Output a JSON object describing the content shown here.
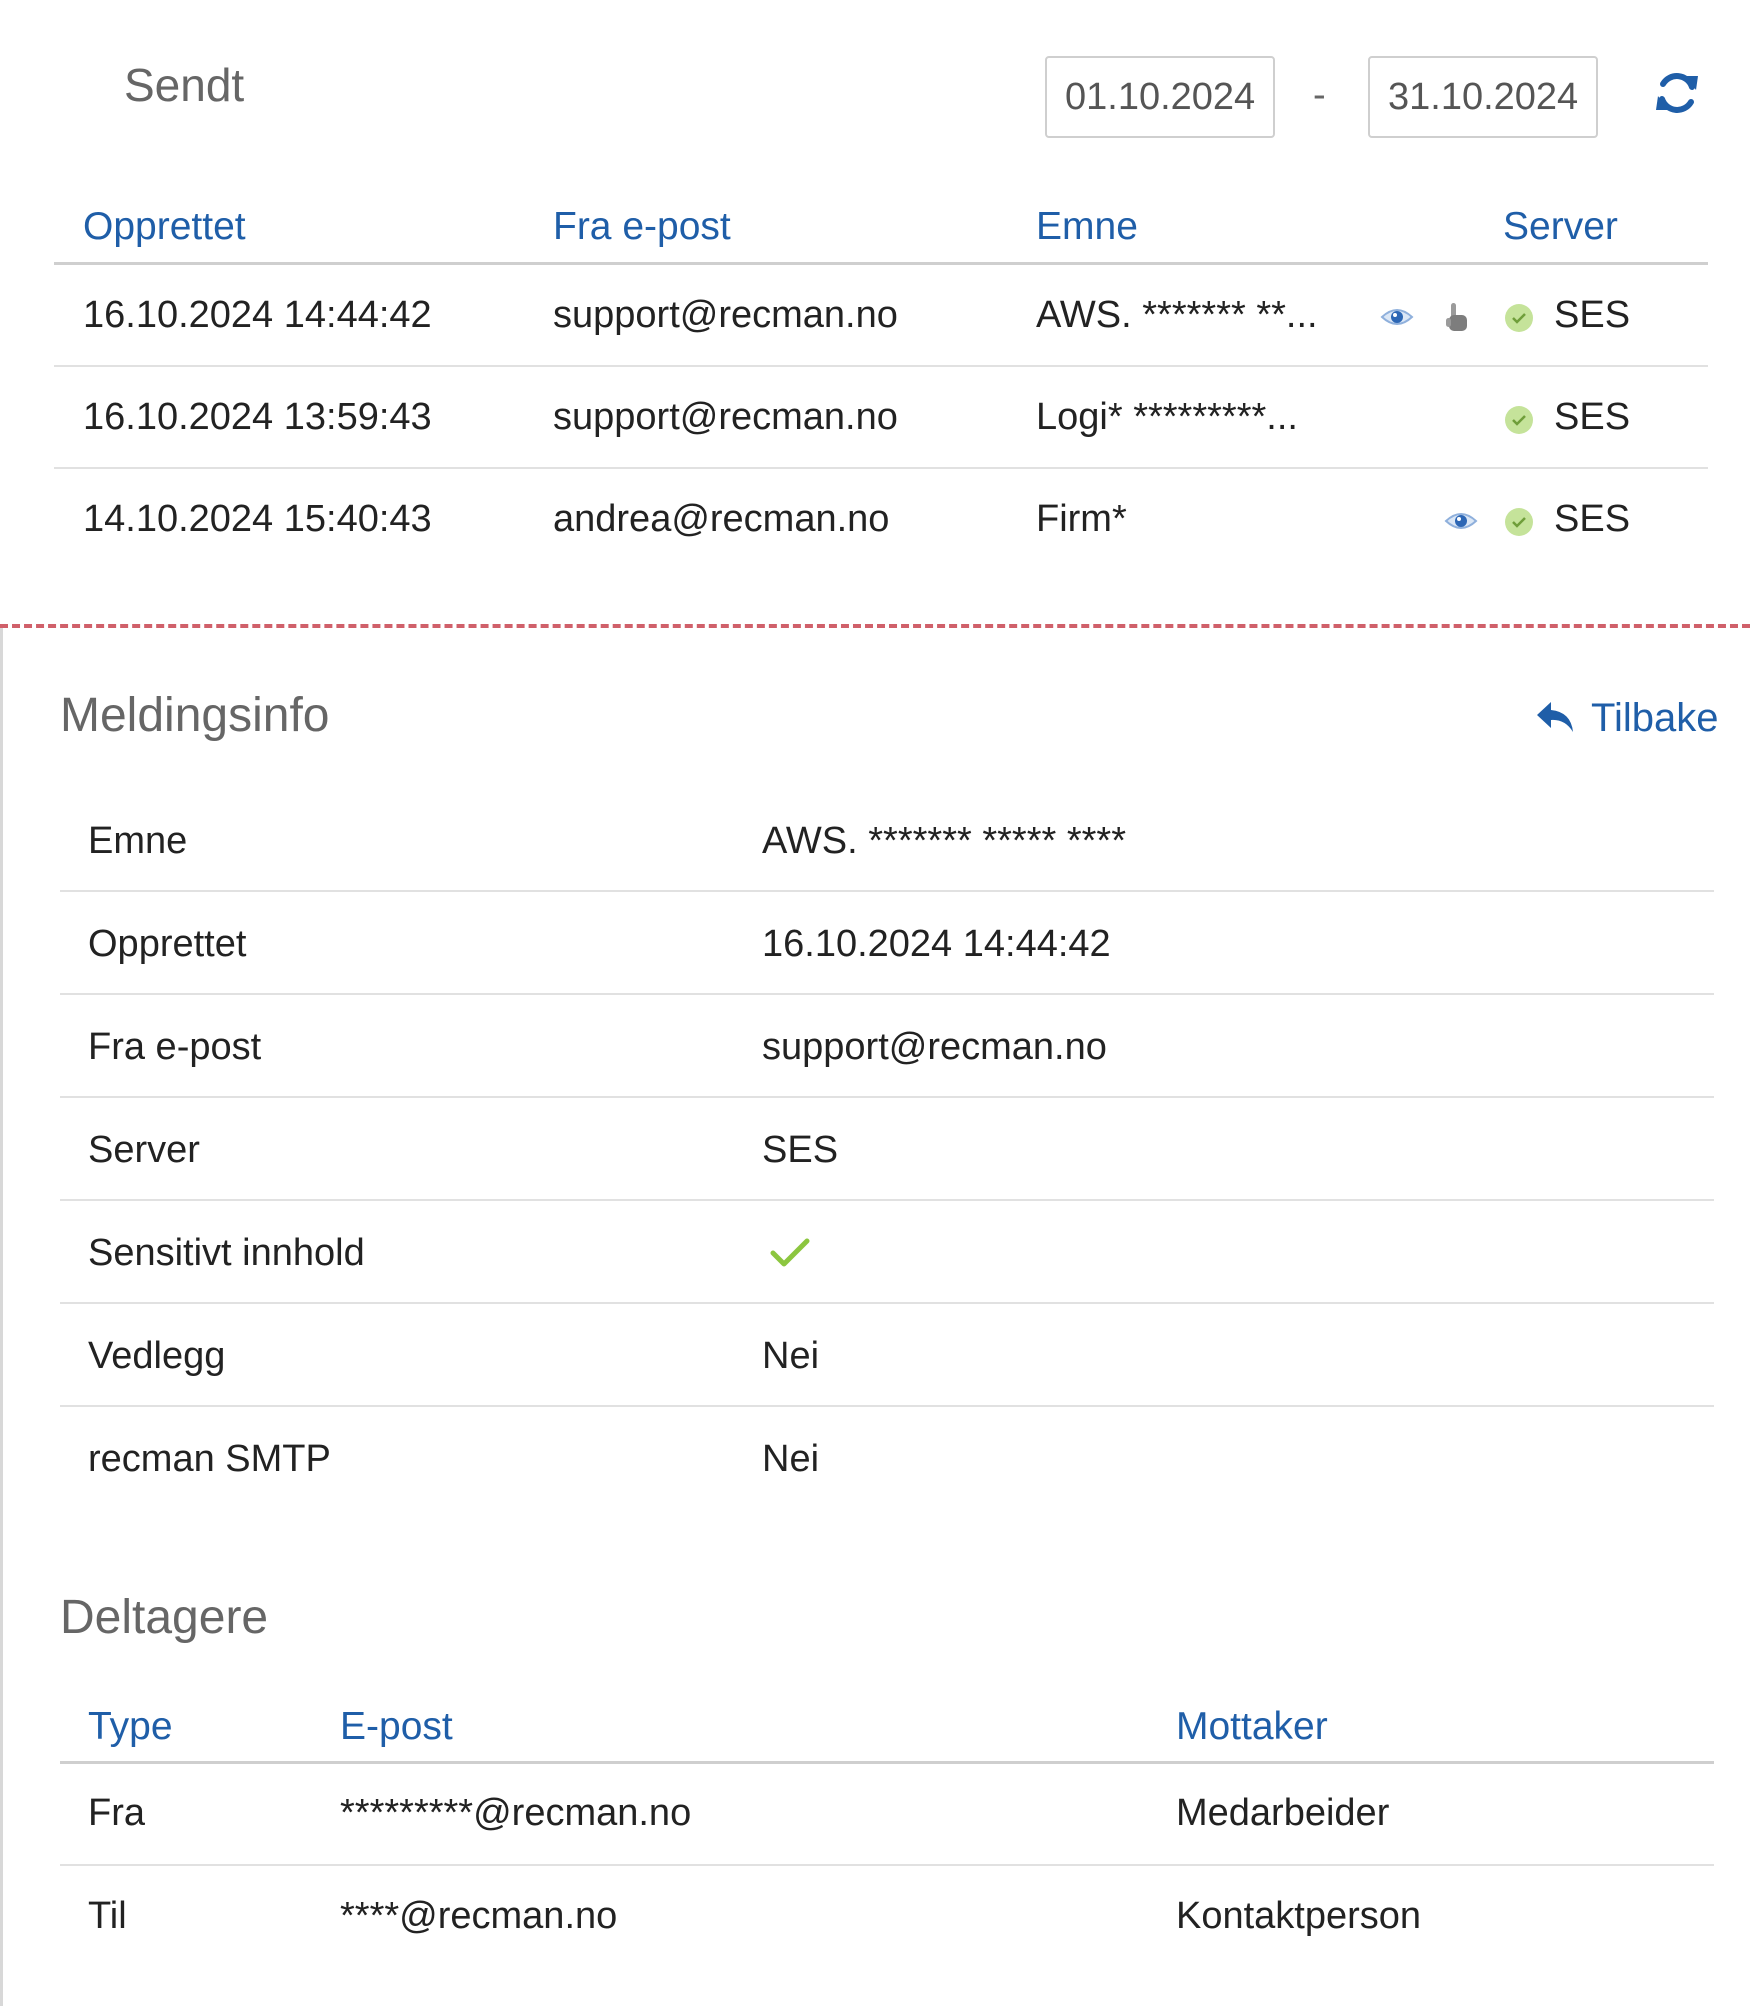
{
  "header": {
    "title": "Sendt",
    "date_from": "01.10.2024",
    "date_separator": "-",
    "date_to": "31.10.2024"
  },
  "list": {
    "columns": [
      "Opprettet",
      "Fra e-post",
      "Emne",
      "Server"
    ],
    "rows": [
      {
        "created": "16.10.2024 14:44:42",
        "from": "support@recman.no",
        "subject": "AWS. ******* **...",
        "server": "SES",
        "has_view_icon": true,
        "has_pointer_icon": true
      },
      {
        "created": "16.10.2024 13:59:43",
        "from": "support@recman.no",
        "subject": "Logi* *********...",
        "server": "SES",
        "has_view_icon": false,
        "has_pointer_icon": false
      },
      {
        "created": "14.10.2024 15:40:43",
        "from": "andrea@recman.no",
        "subject": "Firm*",
        "server": "SES",
        "has_view_icon": true,
        "has_pointer_icon": false
      }
    ]
  },
  "details": {
    "title": "Meldingsinfo",
    "back_label": "Tilbake",
    "rows": [
      {
        "label": "Emne",
        "value": "AWS. ******* ***** ****"
      },
      {
        "label": "Opprettet",
        "value": "16.10.2024 14:44:42"
      },
      {
        "label": "Fra e-post",
        "value": "support@recman.no"
      },
      {
        "label": "Server",
        "value": "SES"
      },
      {
        "label": "Sensitivt innhold",
        "value": "",
        "icon": "check-icon"
      },
      {
        "label": "Vedlegg",
        "value": "Nei"
      },
      {
        "label": "recman SMTP",
        "value": "Nei"
      }
    ]
  },
  "participants": {
    "title": "Deltagere",
    "columns": [
      "Type",
      "E-post",
      "Mottaker"
    ],
    "rows": [
      {
        "type": "Fra",
        "email": "*********@recman.no",
        "recipient": "Medarbeider"
      },
      {
        "type": "Til",
        "email": "****@recman.no",
        "recipient": "Kontaktperson"
      }
    ]
  },
  "colors": {
    "link": "#1f5ea8",
    "status_ok": "#c5e39a",
    "check": "#8cc63f",
    "divider_dashed": "#d0606a"
  }
}
